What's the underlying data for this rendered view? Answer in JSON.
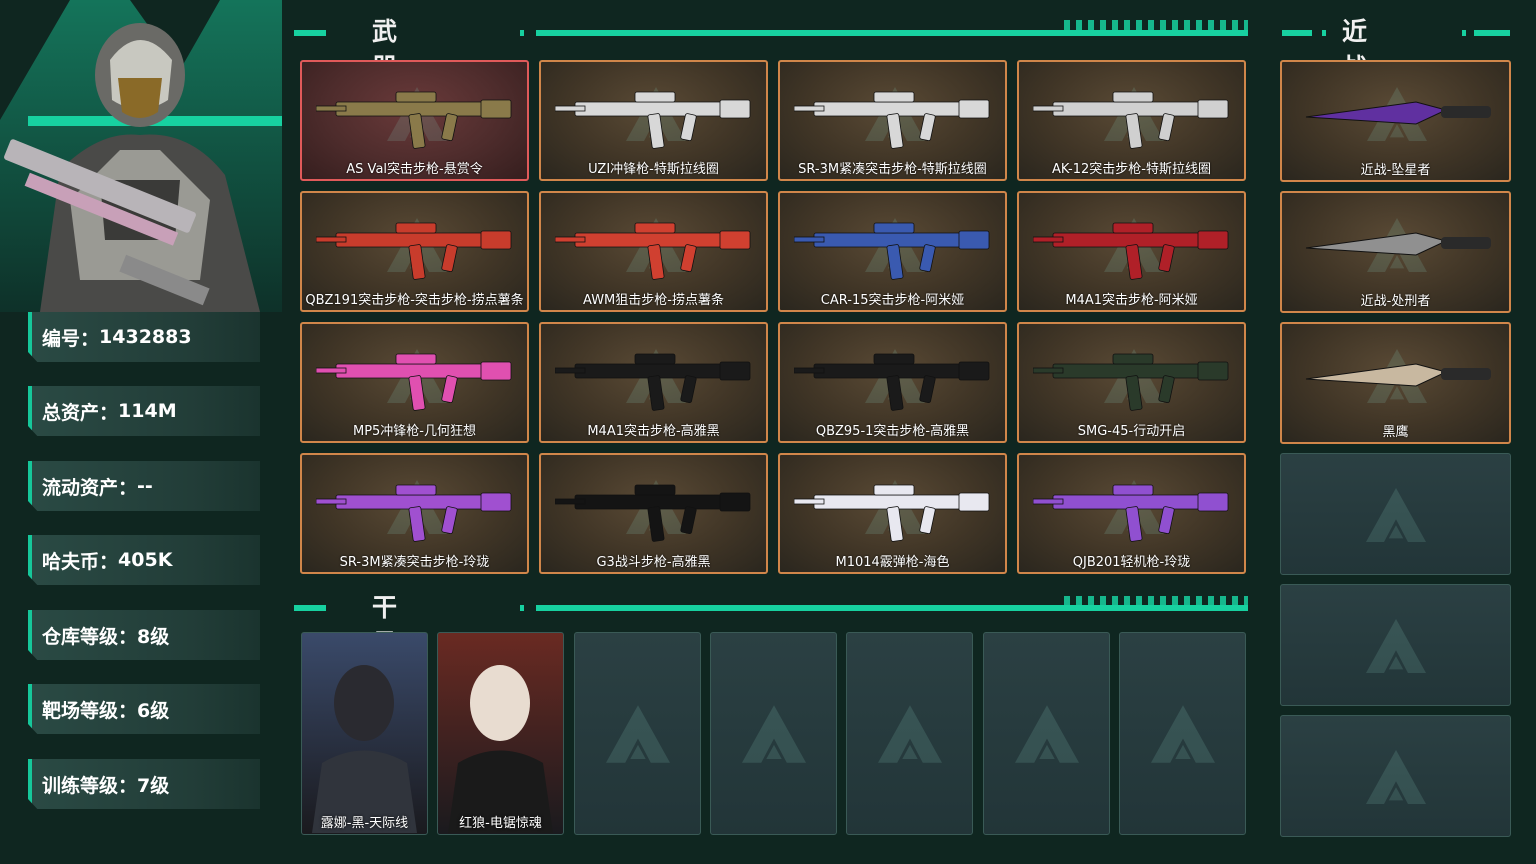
{
  "player": {
    "stats": [
      {
        "label": "编号",
        "value": "1432883"
      },
      {
        "label": "总资产",
        "value": "114M"
      },
      {
        "label": "流动资产",
        "value": "--"
      },
      {
        "label": "哈夫币",
        "value": "405K"
      },
      {
        "label": "仓库等级",
        "value": "8级"
      },
      {
        "label": "靶场等级",
        "value": "6级"
      },
      {
        "label": "训练等级",
        "value": "7级"
      }
    ]
  },
  "sections": {
    "weapons_title": "武器皮肤",
    "melee_title": "近战皮肤",
    "operators_title": "干员皮肤"
  },
  "weapons": [
    {
      "name": "AS Val突击步枪-悬赏令",
      "rarity": "red",
      "color": "#8a7a4a"
    },
    {
      "name": "UZI冲锋枪-特斯拉线圈",
      "rarity": "gold",
      "color": "#d8d8d8"
    },
    {
      "name": "SR-3M紧凑突击步枪-特斯拉线圈",
      "rarity": "gold",
      "color": "#d8d8d8"
    },
    {
      "name": "AK-12突击步枪-特斯拉线圈",
      "rarity": "gold",
      "color": "#d0d0d0"
    },
    {
      "name": "QBZ191突击步枪-突击步枪-捞点薯条",
      "rarity": "gold",
      "color": "#c83c2c"
    },
    {
      "name": "AWM狙击步枪-捞点薯条",
      "rarity": "gold",
      "color": "#d04030"
    },
    {
      "name": "CAR-15突击步枪-阿米娅",
      "rarity": "gold",
      "color": "#3a5ab0"
    },
    {
      "name": "M4A1突击步枪-阿米娅",
      "rarity": "gold",
      "color": "#b02028"
    },
    {
      "name": "MP5冲锋枪-几何狂想",
      "rarity": "gold",
      "color": "#e050b0"
    },
    {
      "name": "M4A1突击步枪-高雅黑",
      "rarity": "gold",
      "color": "#1a1a1a"
    },
    {
      "name": "QBZ95-1突击步枪-高雅黑",
      "rarity": "gold",
      "color": "#1a1a1a"
    },
    {
      "name": "SMG-45-行动开启",
      "rarity": "gold",
      "color": "#2a3a2a"
    },
    {
      "name": "SR-3M紧凑突击步枪-玲珑",
      "rarity": "gold",
      "color": "#a050d0"
    },
    {
      "name": "G3战斗步枪-高雅黑",
      "rarity": "gold",
      "color": "#141414"
    },
    {
      "name": "M1014霰弹枪-海色",
      "rarity": "gold",
      "color": "#e8e8f0"
    },
    {
      "name": "QJB201轻机枪-玲珑",
      "rarity": "gold",
      "color": "#9050d0"
    }
  ],
  "melee": [
    {
      "name": "近战-坠星者",
      "color": "#6030a0"
    },
    {
      "name": "近战-处刑者",
      "color": "#909090"
    },
    {
      "name": "黑鹰",
      "color": "#c8b8a0"
    }
  ],
  "operators": [
    {
      "name": "露娜-黑-天际线",
      "color": "#3a4a6a"
    },
    {
      "name": "红狼-电锯惊魂",
      "color": "#6a2a22"
    }
  ],
  "colors": {
    "accent": "#17d1a0",
    "background": "#0f2620",
    "gold_border": "#d0864a",
    "red_border": "#e05a5a"
  }
}
